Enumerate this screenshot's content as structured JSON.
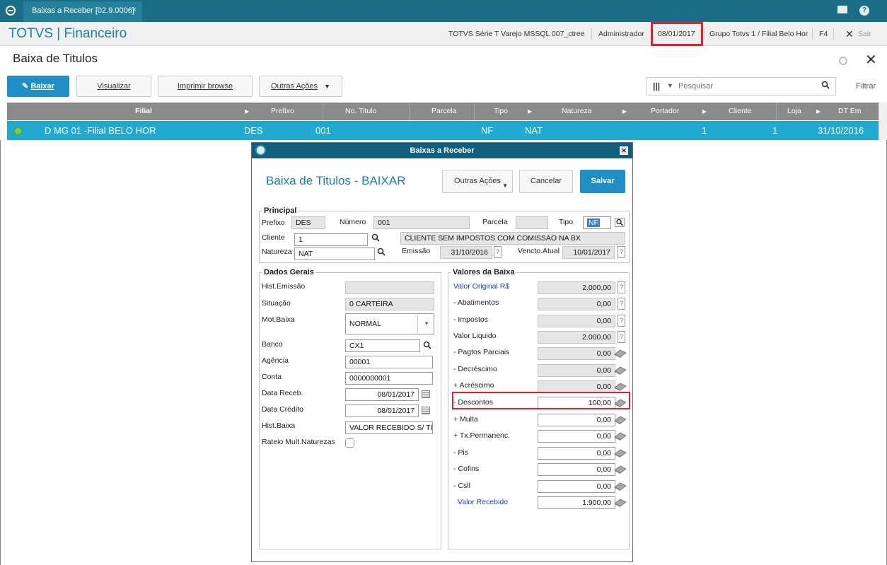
{
  "tabbar": {
    "tab_label": "Baixas a Receber [02.9.0006]",
    "tab_close": "×"
  },
  "header": {
    "brand": "TOTVS | Financeiro",
    "environment": "TOTVS Série T Varejo MSSQL 007_ctree",
    "user": "Administrador",
    "date": "08/01/2017",
    "branch": "Grupo Totvs 1 / Filial Belo Hor",
    "shortcut": "F4",
    "exit": "Sair"
  },
  "page": {
    "title": "Baixa de Titulos"
  },
  "toolbar": {
    "baixar": "Baixar",
    "visualizar": "Visualizar",
    "imprimir": "Imprimir browse",
    "outras": "Outras Ações",
    "search_placeholder": "Pesquisar",
    "filtrar": "Filtrar"
  },
  "grid": {
    "columns": [
      "Filial",
      "Prefixo",
      "No. Titulo",
      "Parcela",
      "Tipo",
      "Natureza",
      "Portador",
      "Cliente",
      "Loja",
      "DT Em"
    ],
    "row": {
      "filial": "D MG 01 -Filial BELO HOR",
      "prefixo": "DES",
      "titulo": "001",
      "tipo": "NF",
      "natureza": "NAT",
      "cliente": "1",
      "loja": "1",
      "dt_emissao": "31/10/2016"
    }
  },
  "dialog": {
    "window_title": "Baixas a Receber",
    "heading": "Baixa de Titulos - BAIXAR",
    "outras_acoes": "Outras Ações",
    "cancelar": "Cancelar",
    "salvar": "Salvar",
    "principal": {
      "legend": "Principal",
      "prefixo_label": "Prefixo",
      "prefixo": "DES",
      "numero_label": "Número",
      "numero": "001",
      "parcela_label": "Parcela",
      "parcela": "",
      "tipo_label": "Tipo",
      "tipo": "NF",
      "cliente_label": "Cliente",
      "cliente": "1",
      "cliente_nome": "CLIENTE SEM IMPOSTOS COM COMISSAO NA BX",
      "natureza_label": "Natureza",
      "natureza": "NAT",
      "emissao_label": "Emissão",
      "emissao": "31/10/2016",
      "vencto_label": "Vencto.Atual",
      "vencto": "10/01/2017"
    },
    "dados": {
      "legend": "Dados Gerais",
      "hist_emissao_label": "Hist.Emissão",
      "hist_emissao": "",
      "situacao_label": "Situação",
      "situacao": "0 CARTEIRA",
      "mot_baixa_label": "Mot.Baixa",
      "mot_baixa": "NORMAL",
      "banco_label": "Banco",
      "banco": "CX1",
      "agencia_label": "Agência",
      "agencia": "00001",
      "conta_label": "Conta",
      "conta": "0000000001",
      "data_receb_label": "Data Receb.",
      "data_receb": "08/01/2017",
      "data_credito_label": "Data Crédito",
      "data_credito": "08/01/2017",
      "hist_baixa_label": "Hist.Baixa",
      "hist_baixa": "VALOR RECEBIDO S/ TIT",
      "rateio_label": "Rateio Mult.Naturezas"
    },
    "valores": {
      "legend": "Valores da Baixa",
      "items": [
        {
          "label": "Valor Original R$",
          "value": "2.000,00"
        },
        {
          "label": "- Abatimentos",
          "value": "0,00"
        },
        {
          "label": "- Impostos",
          "value": "0,00"
        },
        {
          "label": "Valor Liquido",
          "value": "2.000,00"
        },
        {
          "label": "- Pagtos Parciais",
          "value": "0,00"
        },
        {
          "label": "- Decréscimo",
          "value": "0,00"
        },
        {
          "label": "+ Acréscimo",
          "value": "0,00"
        },
        {
          "label": "- Descontos",
          "value": "100,00"
        },
        {
          "label": "+ Multa",
          "value": "0,00"
        },
        {
          "label": "+ Tx.Permanenc.",
          "value": "0,00"
        },
        {
          "label": "- Pis",
          "value": "0,00"
        },
        {
          "label": "- Cofins",
          "value": "0,00"
        },
        {
          "label": "- Csll",
          "value": "0,00"
        },
        {
          "label": "Valor Recebido",
          "value": "1.900,00"
        }
      ]
    }
  },
  "colors": {
    "tabbar": "#1a6d86",
    "brand": "#1a7fa6",
    "primary_button": "#1f8fc6",
    "selected_row": "#20a9d1",
    "grid_header": "#8a8a8a",
    "highlight": "#e3202b"
  }
}
